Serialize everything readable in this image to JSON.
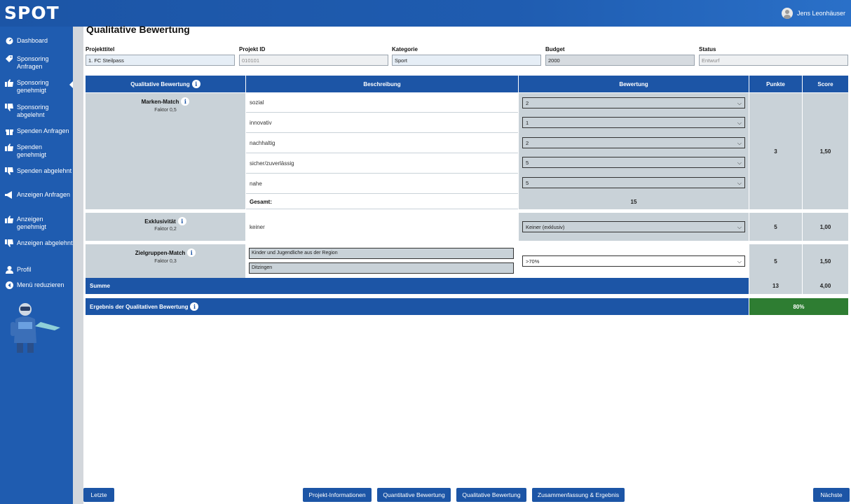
{
  "app": {
    "logo": "SPOT",
    "user_name": "Jens Leonhäuser"
  },
  "sidebar": {
    "items": [
      {
        "label": "Dashboard",
        "icon": "dashboard-icon"
      },
      {
        "label": "Sponsoring Anfragen",
        "icon": "tag-icon"
      },
      {
        "label": "Sponsoring genehmigt",
        "icon": "thumbs-up-icon"
      },
      {
        "label": "Sponsoring abgelehnt",
        "icon": "thumbs-down-icon"
      },
      {
        "label": "Spenden Anfragen",
        "icon": "gift-icon"
      },
      {
        "label": "Spenden genehmigt",
        "icon": "thumbs-up-icon"
      },
      {
        "label": "Spenden abgelehnt",
        "icon": "thumbs-down-icon"
      },
      {
        "label": "Anzeigen Anfragen",
        "icon": "megaphone-icon"
      },
      {
        "label": "Anzeigen genehmigt",
        "icon": "thumbs-up-icon"
      },
      {
        "label": "Anzeigen abgelehnt",
        "icon": "thumbs-down-icon"
      },
      {
        "label": "Profil",
        "icon": "user-icon"
      },
      {
        "label": "Menü reduzieren",
        "icon": "collapse-icon"
      }
    ]
  },
  "page": {
    "title": "Qualitative Bewertung"
  },
  "fields": {
    "projekttitel": {
      "label": "Projekttitel",
      "value": "1. FC Steilpass"
    },
    "projekt_id": {
      "label": "Projekt ID",
      "value": "010101"
    },
    "kategorie": {
      "label": "Kategorie",
      "value": "Sport"
    },
    "budget": {
      "label": "Budget",
      "value": "2000"
    },
    "status": {
      "label": "Status",
      "value": "Entwurf"
    }
  },
  "table": {
    "headers": {
      "qualitative": "Qualitative Bewertung",
      "beschreibung": "Beschreibung",
      "bewertung": "Bewertung",
      "punkte": "Punkte",
      "score": "Score"
    },
    "marken_match": {
      "title": "Marken-Match",
      "faktor": "Faktor 0,5",
      "rows": [
        {
          "desc": "sozial",
          "value": "2"
        },
        {
          "desc": "innovativ",
          "value": "1"
        },
        {
          "desc": "nachhaltig",
          "value": "2"
        },
        {
          "desc": "sicher/zuverlässig",
          "value": "5"
        },
        {
          "desc": "nahe",
          "value": "5"
        }
      ],
      "gesamt_label": "Gesamt:",
      "gesamt_value": "15",
      "punkte": "3",
      "score": "1,50"
    },
    "exklusivitaet": {
      "title": "Exklusivität",
      "faktor": "Faktor 0,2",
      "desc": "keiner",
      "value": "Keiner (exklusiv)",
      "punkte": "5",
      "score": "1,00"
    },
    "zielgruppen": {
      "title": "Zielgruppen-Match",
      "faktor": "Faktor 0,3",
      "text1": "Kinder und Jugendliche aus der Region",
      "text2": "Ditzingen",
      "value": ">70%",
      "punkte": "5",
      "score": "1,50"
    },
    "summe": {
      "label": "Summe",
      "punkte": "13",
      "score": "4,00"
    },
    "ergebnis": {
      "label": "Ergebnis der Qualitativen Bewertung",
      "value": "80%"
    }
  },
  "buttons": {
    "letzte": "Letzte",
    "projekt_info": "Projekt-Informationen",
    "quantitativ": "Quantitative Bewertung",
    "qualitativ": "Qualitative Bewertung",
    "zusammenfassung": "Zusammenfassung & Ergebnis",
    "naechste": "Nächste"
  },
  "colors": {
    "primary": "#1c55a6",
    "sidebar": "#1f5cb0",
    "gray_cell": "#c9d2d8",
    "success": "#2e7d32"
  }
}
